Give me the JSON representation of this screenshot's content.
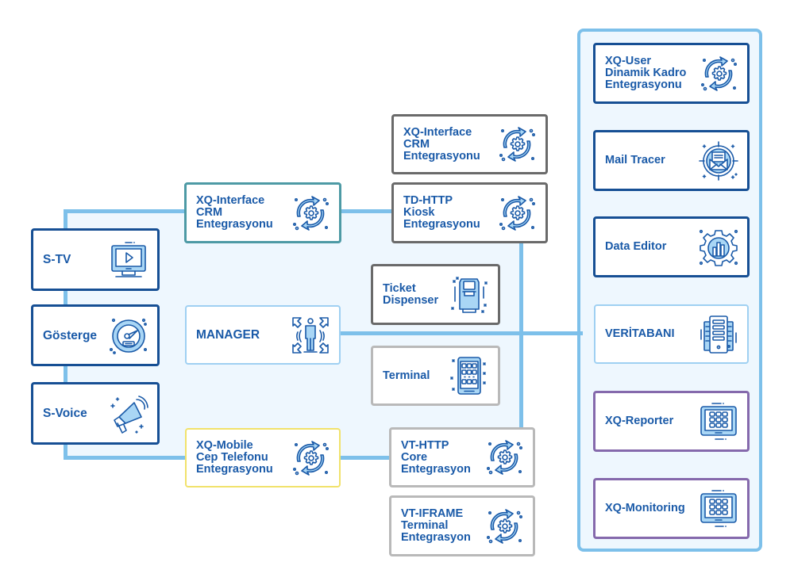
{
  "diagram": {
    "title": "",
    "left_clients": [
      {
        "id": "s-tv",
        "label": "S-TV",
        "icon": "tv-play-icon"
      },
      {
        "id": "gosterge",
        "label": "Gösterge",
        "icon": "gauge-icon"
      },
      {
        "id": "s-voice",
        "label": "S-Voice",
        "icon": "megaphone-icon"
      }
    ],
    "middle_left": [
      {
        "id": "xq-interface-crm-left",
        "label": "XQ-Interface\nCRM\nEntegrasyonu",
        "icon": "sync-gear-icon"
      },
      {
        "id": "manager",
        "label": "MANAGER",
        "icon": "manager-person-icon"
      },
      {
        "id": "xq-mobile",
        "label": "XQ-Mobile\nCep Telefonu\nEntegrasyonu",
        "icon": "sync-gear-icon"
      }
    ],
    "middle_right": [
      {
        "id": "xq-interface-crm-top",
        "label": "XQ-Interface\nCRM\nEntegrasyonu",
        "icon": "sync-gear-icon"
      },
      {
        "id": "td-http",
        "label": "TD-HTTP\nKiosk\nEntegrasyonu",
        "icon": "sync-gear-icon"
      },
      {
        "id": "ticket-dispenser",
        "label": "Ticket\nDispenser",
        "icon": "kiosk-icon"
      },
      {
        "id": "terminal",
        "label": "Terminal",
        "icon": "tablet-grid-icon"
      },
      {
        "id": "vt-http",
        "label": "VT-HTTP\nCore\nEntegrasyon",
        "icon": "sync-gear-icon"
      },
      {
        "id": "vt-iframe",
        "label": "VT-IFRAME\nTerminal\nEntegrasyon",
        "icon": "sync-gear-icon"
      }
    ],
    "right_column": [
      {
        "id": "xq-user",
        "label": "XQ-User\nDinamik Kadro\nEntegrasyonu",
        "icon": "sync-gear-icon"
      },
      {
        "id": "mail-tracer",
        "label": "Mail Tracer",
        "icon": "mail-target-icon"
      },
      {
        "id": "data-editor",
        "label": "Data Editor",
        "icon": "gear-chart-icon"
      },
      {
        "id": "veritabani",
        "label": "VERİTABANI",
        "icon": "database-servers-icon"
      },
      {
        "id": "xq-reporter",
        "label": "XQ-Reporter",
        "icon": "tablet-grid-icon"
      },
      {
        "id": "xq-monitoring",
        "label": "XQ-Monitoring",
        "icon": "tablet-grid-icon"
      }
    ]
  },
  "colors": {
    "text": "#1a5aa8",
    "connector": "#7dc0ea",
    "panel_fill": "#eef7fe",
    "border_navy": "#164f94",
    "border_teal": "#4d9aa5",
    "border_sky": "#9fd0f2",
    "border_yellow": "#f1e26b",
    "border_dark_gray": "#6a6a6a",
    "border_light_gray": "#b9b9b9",
    "border_purple": "#8569ac"
  }
}
